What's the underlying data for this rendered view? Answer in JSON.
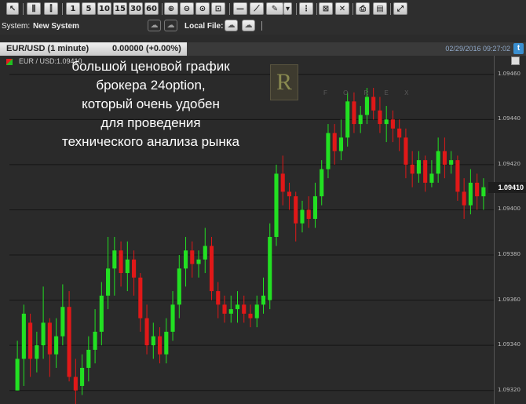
{
  "toolbar": {
    "timeframes": [
      "1",
      "5",
      "10",
      "15",
      "30",
      "60"
    ]
  },
  "system": {
    "label": "System:",
    "name": "New System",
    "local_file_label": "Local File:"
  },
  "tab": {
    "symbol_label": "EUR/USD (1 minute)",
    "change_label": "0.00000 (+0.00%)"
  },
  "datetime": "02/29/2016 09:27:02",
  "legend": "EUR / USD:1.09410",
  "price_tag": "1.09410",
  "overlay_text": [
    "большой ценовой график",
    "брокера 24option,",
    "который очень удобен",
    "для проведения",
    "технического анализа рынка"
  ],
  "logo": {
    "letter": "R",
    "sub": "F O R E X"
  },
  "colors": {
    "up": "#22e022",
    "down": "#e01818",
    "background": "#2a2a2a",
    "grid": "#141414"
  },
  "chart_data": {
    "type": "candlestick",
    "symbol": "EUR / USD",
    "interval": "1 minute",
    "ylim": [
      1.09314,
      1.09462
    ],
    "yticks": [
      1.0946,
      1.0944,
      1.0942,
      1.094,
      1.0938,
      1.0936,
      1.0934,
      1.0932
    ],
    "last": 1.0941,
    "candles": [
      {
        "o": 1.0932,
        "c": 1.09334,
        "h": 1.09342,
        "l": 1.0932
      },
      {
        "o": 1.09334,
        "c": 1.09354,
        "h": 1.09358,
        "l": 1.09322
      },
      {
        "o": 1.0935,
        "c": 1.09334,
        "h": 1.09354,
        "l": 1.09326
      },
      {
        "o": 1.09334,
        "c": 1.0934,
        "h": 1.09346,
        "l": 1.09328
      },
      {
        "o": 1.0934,
        "c": 1.0935,
        "h": 1.09366,
        "l": 1.09334
      },
      {
        "o": 1.0935,
        "c": 1.09336,
        "h": 1.09352,
        "l": 1.09326
      },
      {
        "o": 1.09336,
        "c": 1.09344,
        "h": 1.09352,
        "l": 1.0933
      },
      {
        "o": 1.09344,
        "c": 1.09357,
        "h": 1.09367,
        "l": 1.0934
      },
      {
        "o": 1.09357,
        "c": 1.09326,
        "h": 1.09364,
        "l": 1.09324
      },
      {
        "o": 1.09326,
        "c": 1.0932,
        "h": 1.09334,
        "l": 1.09312
      },
      {
        "o": 1.09322,
        "c": 1.0933,
        "h": 1.09336,
        "l": 1.09318
      },
      {
        "o": 1.0933,
        "c": 1.09338,
        "h": 1.09344,
        "l": 1.09324
      },
      {
        "o": 1.09338,
        "c": 1.09346,
        "h": 1.09356,
        "l": 1.09332
      },
      {
        "o": 1.09346,
        "c": 1.09362,
        "h": 1.09368,
        "l": 1.0934
      },
      {
        "o": 1.09362,
        "c": 1.09374,
        "h": 1.09388,
        "l": 1.09356
      },
      {
        "o": 1.09374,
        "c": 1.09382,
        "h": 1.09388,
        "l": 1.09362
      },
      {
        "o": 1.09382,
        "c": 1.09372,
        "h": 1.09386,
        "l": 1.09366
      },
      {
        "o": 1.09372,
        "c": 1.09378,
        "h": 1.09386,
        "l": 1.09364
      },
      {
        "o": 1.09378,
        "c": 1.0937,
        "h": 1.09382,
        "l": 1.09362
      },
      {
        "o": 1.0937,
        "c": 1.09352,
        "h": 1.09372,
        "l": 1.09346
      },
      {
        "o": 1.09352,
        "c": 1.0934,
        "h": 1.09358,
        "l": 1.09336
      },
      {
        "o": 1.0934,
        "c": 1.09344,
        "h": 1.0935,
        "l": 1.09334
      },
      {
        "o": 1.09344,
        "c": 1.09336,
        "h": 1.09348,
        "l": 1.09332
      },
      {
        "o": 1.09336,
        "c": 1.09346,
        "h": 1.09352,
        "l": 1.09332
      },
      {
        "o": 1.09346,
        "c": 1.09358,
        "h": 1.09364,
        "l": 1.09342
      },
      {
        "o": 1.09358,
        "c": 1.09374,
        "h": 1.0938,
        "l": 1.09352
      },
      {
        "o": 1.09374,
        "c": 1.09382,
        "h": 1.09388,
        "l": 1.09366
      },
      {
        "o": 1.09382,
        "c": 1.09376,
        "h": 1.09386,
        "l": 1.0937
      },
      {
        "o": 1.09376,
        "c": 1.09378,
        "h": 1.09382,
        "l": 1.0937
      },
      {
        "o": 1.09378,
        "c": 1.09384,
        "h": 1.09392,
        "l": 1.09372
      },
      {
        "o": 1.09384,
        "c": 1.09364,
        "h": 1.09388,
        "l": 1.0936
      },
      {
        "o": 1.09364,
        "c": 1.09358,
        "h": 1.09368,
        "l": 1.09352
      },
      {
        "o": 1.09358,
        "c": 1.09354,
        "h": 1.09362,
        "l": 1.0935
      },
      {
        "o": 1.09354,
        "c": 1.09356,
        "h": 1.09362,
        "l": 1.0935
      },
      {
        "o": 1.09356,
        "c": 1.09358,
        "h": 1.09364,
        "l": 1.0935
      },
      {
        "o": 1.09358,
        "c": 1.09354,
        "h": 1.09362,
        "l": 1.0935
      },
      {
        "o": 1.09354,
        "c": 1.09352,
        "h": 1.09358,
        "l": 1.09348
      },
      {
        "o": 1.09352,
        "c": 1.09358,
        "h": 1.09362,
        "l": 1.09348
      },
      {
        "o": 1.09358,
        "c": 1.09362,
        "h": 1.0937,
        "l": 1.09354
      },
      {
        "o": 1.0936,
        "c": 1.09388,
        "h": 1.09394,
        "l": 1.09356
      },
      {
        "o": 1.09388,
        "c": 1.09416,
        "h": 1.0942,
        "l": 1.09384
      },
      {
        "o": 1.09416,
        "c": 1.09408,
        "h": 1.09424,
        "l": 1.09402
      },
      {
        "o": 1.09408,
        "c": 1.09406,
        "h": 1.09412,
        "l": 1.094
      },
      {
        "o": 1.09406,
        "c": 1.09394,
        "h": 1.09408,
        "l": 1.09386
      },
      {
        "o": 1.09394,
        "c": 1.094,
        "h": 1.09404,
        "l": 1.0939
      },
      {
        "o": 1.094,
        "c": 1.09396,
        "h": 1.09406,
        "l": 1.09392
      },
      {
        "o": 1.09396,
        "c": 1.09406,
        "h": 1.09412,
        "l": 1.09392
      },
      {
        "o": 1.09406,
        "c": 1.09418,
        "h": 1.09422,
        "l": 1.09402
      },
      {
        "o": 1.09418,
        "c": 1.09434,
        "h": 1.09438,
        "l": 1.09414
      },
      {
        "o": 1.09434,
        "c": 1.09426,
        "h": 1.09438,
        "l": 1.0942
      },
      {
        "o": 1.09426,
        "c": 1.09432,
        "h": 1.0944,
        "l": 1.09422
      },
      {
        "o": 1.09432,
        "c": 1.09448,
        "h": 1.09452,
        "l": 1.09428
      },
      {
        "o": 1.09448,
        "c": 1.09438,
        "h": 1.09452,
        "l": 1.09434
      },
      {
        "o": 1.09438,
        "c": 1.09442,
        "h": 1.09446,
        "l": 1.09434
      },
      {
        "o": 1.09442,
        "c": 1.0945,
        "h": 1.09454,
        "l": 1.09438
      },
      {
        "o": 1.0945,
        "c": 1.09444,
        "h": 1.09454,
        "l": 1.0944
      },
      {
        "o": 1.09444,
        "c": 1.09438,
        "h": 1.0945,
        "l": 1.09434
      },
      {
        "o": 1.09438,
        "c": 1.0944,
        "h": 1.09446,
        "l": 1.0943
      },
      {
        "o": 1.0944,
        "c": 1.09436,
        "h": 1.09444,
        "l": 1.0943
      },
      {
        "o": 1.09436,
        "c": 1.09432,
        "h": 1.0944,
        "l": 1.09426
      },
      {
        "o": 1.09432,
        "c": 1.0942,
        "h": 1.09436,
        "l": 1.09414
      },
      {
        "o": 1.0942,
        "c": 1.09416,
        "h": 1.09426,
        "l": 1.0941
      },
      {
        "o": 1.09416,
        "c": 1.09422,
        "h": 1.09426,
        "l": 1.09412
      },
      {
        "o": 1.09422,
        "c": 1.09412,
        "h": 1.09424,
        "l": 1.09408
      },
      {
        "o": 1.09412,
        "c": 1.09416,
        "h": 1.09422,
        "l": 1.0941
      },
      {
        "o": 1.09416,
        "c": 1.09426,
        "h": 1.09432,
        "l": 1.09412
      },
      {
        "o": 1.09426,
        "c": 1.0942,
        "h": 1.09432,
        "l": 1.09414
      },
      {
        "o": 1.0942,
        "c": 1.09422,
        "h": 1.09426,
        "l": 1.09416
      },
      {
        "o": 1.09422,
        "c": 1.09408,
        "h": 1.09424,
        "l": 1.09404
      },
      {
        "o": 1.09408,
        "c": 1.09402,
        "h": 1.09414,
        "l": 1.09396
      },
      {
        "o": 1.09402,
        "c": 1.09412,
        "h": 1.09418,
        "l": 1.09398
      },
      {
        "o": 1.09412,
        "c": 1.09406,
        "h": 1.09416,
        "l": 1.094
      },
      {
        "o": 1.09406,
        "c": 1.0941,
        "h": 1.09414,
        "l": 1.094
      }
    ]
  }
}
